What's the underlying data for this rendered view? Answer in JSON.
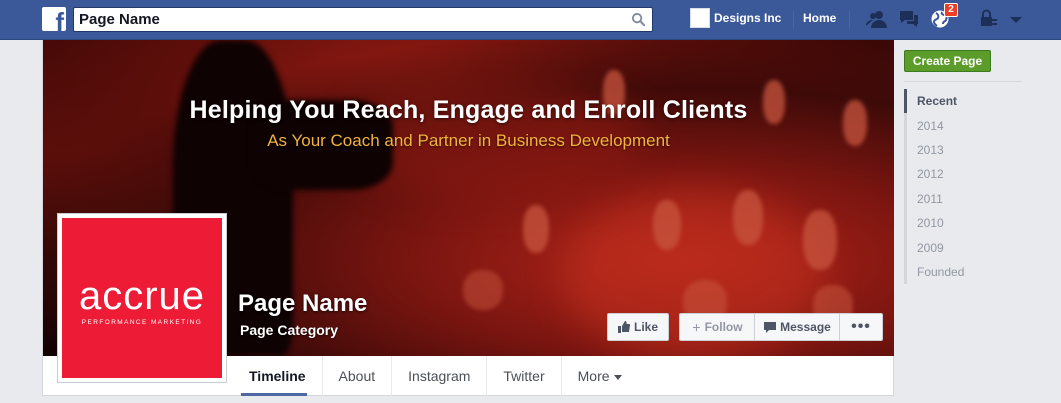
{
  "topbar": {
    "logo_letter": "f",
    "search_value": "Page Name",
    "user_name": "Designs Inc",
    "home_label": "Home",
    "notification_count": "2"
  },
  "cover": {
    "headline": "Helping You Reach, Engage and Enroll Clients",
    "subheadline": "As Your Coach and Partner in Business Development"
  },
  "profile": {
    "logo_word": "accrue",
    "logo_tagline": "PERFORMANCE MARKETING",
    "logo_color": "#ee1b36"
  },
  "page": {
    "name": "Page Name",
    "category": "Page Category"
  },
  "actions": {
    "like": "Like",
    "follow": "Follow",
    "message": "Message",
    "more": "•••"
  },
  "tabs": [
    {
      "label": "Timeline",
      "active": true
    },
    {
      "label": "About"
    },
    {
      "label": "Instagram"
    },
    {
      "label": "Twitter"
    },
    {
      "label": "More"
    }
  ],
  "sidebar": {
    "create_page": "Create Page",
    "years": [
      "Recent",
      "2014",
      "2013",
      "2012",
      "2011",
      "2010",
      "2009",
      "Founded"
    ]
  },
  "colors": {
    "brand_blue": "#3b5998",
    "create_green": "#5b9c2a",
    "badge_red": "#f03d25"
  }
}
